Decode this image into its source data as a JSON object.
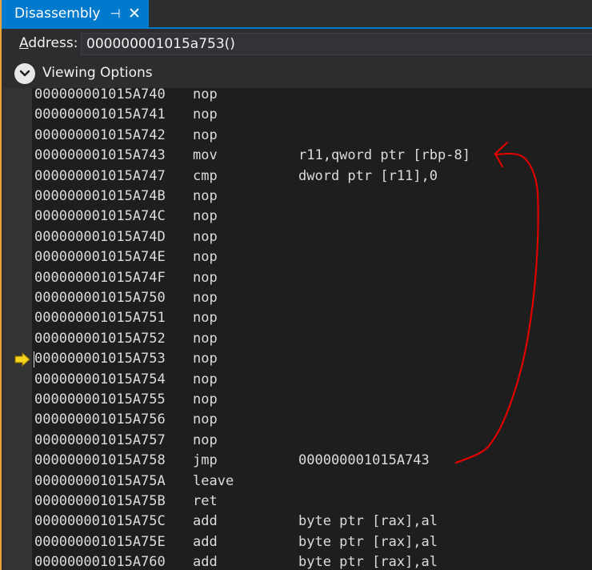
{
  "tab": {
    "title": "Disassembly",
    "pin_glyph": "⊣",
    "close_glyph": "✕"
  },
  "address": {
    "label_underlined": "A",
    "label_rest": "ddress:",
    "value": "000000001015a753()"
  },
  "viewing_options": {
    "label": "Viewing Options"
  },
  "current_instruction_index": 13,
  "rows": [
    {
      "addr": "000000001015A740",
      "mnemonic": "nop",
      "operands": ""
    },
    {
      "addr": "000000001015A741",
      "mnemonic": "nop",
      "operands": ""
    },
    {
      "addr": "000000001015A742",
      "mnemonic": "nop",
      "operands": ""
    },
    {
      "addr": "000000001015A743",
      "mnemonic": "mov",
      "operands": "r11,qword ptr [rbp-8]"
    },
    {
      "addr": "000000001015A747",
      "mnemonic": "cmp",
      "operands": "dword ptr [r11],0"
    },
    {
      "addr": "000000001015A74B",
      "mnemonic": "nop",
      "operands": ""
    },
    {
      "addr": "000000001015A74C",
      "mnemonic": "nop",
      "operands": ""
    },
    {
      "addr": "000000001015A74D",
      "mnemonic": "nop",
      "operands": ""
    },
    {
      "addr": "000000001015A74E",
      "mnemonic": "nop",
      "operands": ""
    },
    {
      "addr": "000000001015A74F",
      "mnemonic": "nop",
      "operands": ""
    },
    {
      "addr": "000000001015A750",
      "mnemonic": "nop",
      "operands": ""
    },
    {
      "addr": "000000001015A751",
      "mnemonic": "nop",
      "operands": ""
    },
    {
      "addr": "000000001015A752",
      "mnemonic": "nop",
      "operands": ""
    },
    {
      "addr": "000000001015A753",
      "mnemonic": "nop",
      "operands": ""
    },
    {
      "addr": "000000001015A754",
      "mnemonic": "nop",
      "operands": ""
    },
    {
      "addr": "000000001015A755",
      "mnemonic": "nop",
      "operands": ""
    },
    {
      "addr": "000000001015A756",
      "mnemonic": "nop",
      "operands": ""
    },
    {
      "addr": "000000001015A757",
      "mnemonic": "nop",
      "operands": ""
    },
    {
      "addr": "000000001015A758",
      "mnemonic": "jmp",
      "operands": "000000001015A743"
    },
    {
      "addr": "000000001015A75A",
      "mnemonic": "leave",
      "operands": ""
    },
    {
      "addr": "000000001015A75B",
      "mnemonic": "ret",
      "operands": ""
    },
    {
      "addr": "000000001015A75C",
      "mnemonic": "add",
      "operands": "byte ptr [rax],al"
    },
    {
      "addr": "000000001015A75E",
      "mnemonic": "add",
      "operands": "byte ptr [rax],al"
    },
    {
      "addr": "000000001015A760",
      "mnemonic": "add",
      "operands": "byte ptr [rax],al"
    }
  ],
  "colors": {
    "accent": "#007acc",
    "panel_edge": "#e8a33a",
    "instruction_pointer": "#f5d21c",
    "annotation": "#e00000"
  }
}
